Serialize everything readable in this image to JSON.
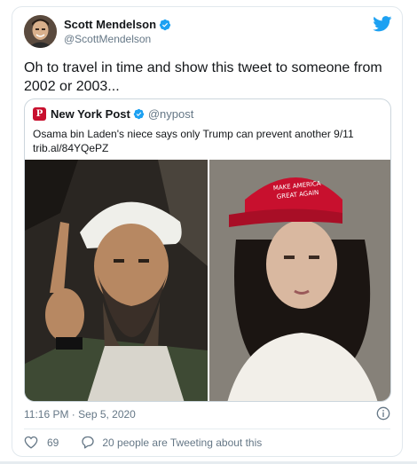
{
  "tweet": {
    "author": {
      "display_name": "Scott Mendelson",
      "handle": "@ScottMendelson",
      "verified": true,
      "avatar": "avatar"
    },
    "text": "Oh to travel in time and show this tweet to someone from 2002 or 2003...",
    "timestamp": "11:16 PM · Sep 5, 2020",
    "likes": "69",
    "replies_text": "20 people are Tweeting about this"
  },
  "quote": {
    "author": {
      "display_name": "New York Post",
      "handle": "@nypost",
      "verified": true,
      "avatar_letter": "P"
    },
    "text_line1": "Osama bin Laden's niece says only Trump can prevent another 9/11",
    "text_line2": "trib.al/84YQePZ",
    "hat_text_line1": "MAKE AMERICA",
    "hat_text_line2": "GREAT AGAIN"
  },
  "icons": {
    "logo": "twitter-bird-icon",
    "verified": "verified-badge-icon",
    "info": "info-icon",
    "like": "heart-icon",
    "reply": "speech-bubble-icon"
  },
  "colors": {
    "brand": "#1da1f2",
    "text": "#14171a",
    "muted": "#657786",
    "border": "#e1e8ed",
    "nypost_red": "#c8102e",
    "hat_red": "#c8102e"
  }
}
